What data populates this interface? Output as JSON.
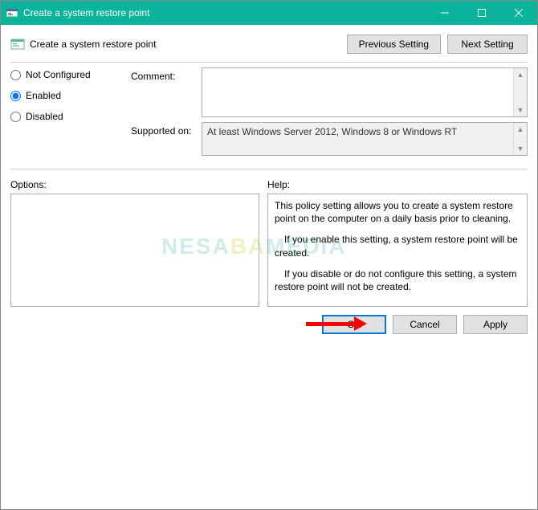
{
  "window": {
    "title": "Create a system restore point"
  },
  "header": {
    "policy_title": "Create a system restore point",
    "prev_label": "Previous Setting",
    "next_label": "Next Setting"
  },
  "state": {
    "not_configured_label": "Not Configured",
    "enabled_label": "Enabled",
    "disabled_label": "Disabled",
    "selected": "enabled"
  },
  "comment": {
    "label": "Comment:",
    "value": ""
  },
  "supported": {
    "label": "Supported on:",
    "value": "At least Windows Server 2012, Windows 8 or Windows RT"
  },
  "options": {
    "label": "Options:",
    "content": ""
  },
  "help": {
    "label": "Help:",
    "p1": "This policy setting allows you to create a system restore point on the computer on a daily basis prior to cleaning.",
    "p2": "If you enable this setting, a system restore point will be created.",
    "p3": "If you disable or do not configure this setting, a system restore point will not be created."
  },
  "footer": {
    "ok": "OK",
    "cancel": "Cancel",
    "apply": "Apply"
  },
  "watermark": {
    "text_a": "NESA",
    "text_b": "BA",
    "text_c": "MEDIA"
  }
}
